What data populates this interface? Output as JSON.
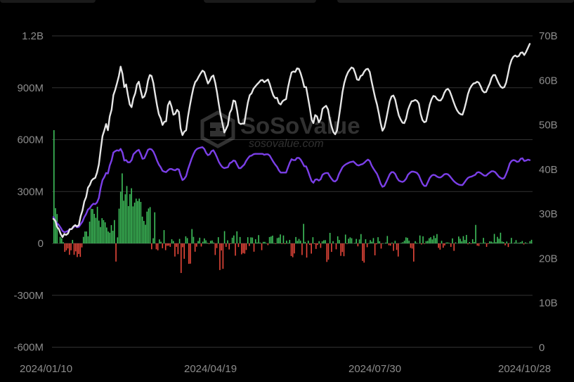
{
  "chart_data": {
    "type": "bar",
    "watermark": {
      "brand": "SoSoValue",
      "url": "sosovalue.com"
    },
    "left_axis": {
      "ticks": [
        {
          "value": 1200000000,
          "label": "1.2B"
        },
        {
          "value": 900000000,
          "label": "900M"
        },
        {
          "value": 600000000,
          "label": "600M"
        },
        {
          "value": 300000000,
          "label": "300M"
        },
        {
          "value": 0,
          "label": "0"
        },
        {
          "value": -300000000,
          "label": "-300M"
        },
        {
          "value": -600000000,
          "label": "-600M"
        }
      ],
      "ylim": [
        -600000000,
        1200000000
      ]
    },
    "right_axis": {
      "ticks": [
        {
          "value": 70000000000,
          "label": "70B"
        },
        {
          "value": 60000000000,
          "label": "60B"
        },
        {
          "value": 50000000000,
          "label": "50B"
        },
        {
          "value": 40000000000,
          "label": "40B"
        },
        {
          "value": 30000000000,
          "label": "30B"
        },
        {
          "value": 20000000000,
          "label": "20B"
        },
        {
          "value": 10000000000,
          "label": "10B"
        },
        {
          "value": 0,
          "label": "0"
        }
      ],
      "ylim": [
        0,
        70000000000
      ]
    },
    "x_ticks": [
      "2024/01/10",
      "2024/04/19",
      "2024/07/30",
      "2024/10/28"
    ],
    "x_range": [
      "2024/01/11",
      "2024/10/30"
    ],
    "grid": true,
    "colors": {
      "positive": "#3fc25c",
      "negative": "#e8473a",
      "line_white": "#e6e6e6",
      "line_purple": "#7b3fe8",
      "grid": "#333333",
      "axis_text": "#8c8c8c",
      "background": "#000000"
    },
    "series": [
      {
        "type": "bar",
        "axis": "left",
        "values": [
          655,
          204,
          170,
          0,
          38,
          29,
          7,
          -49,
          -40,
          -29,
          -66,
          -40,
          20,
          -66,
          -46,
          -79,
          -61,
          -78,
          -23,
          38,
          69,
          69,
          41,
          126,
          200,
          199,
          171,
          148,
          212,
          132,
          95,
          146,
          135,
          122,
          92,
          69,
          62,
          106,
          73,
          135,
          -105,
          35,
          201,
          299,
          405,
          247,
          284,
          332,
          216,
          285,
          319,
          214,
          236,
          259,
          245,
          259,
          240,
          155,
          130,
          108,
          184,
          202,
          210,
          -34,
          30,
          180,
          -34,
          -40,
          23,
          10,
          -28,
          77,
          -39,
          -14,
          -13,
          -20,
          24,
          14,
          -76,
          -20,
          -62,
          26,
          -171,
          -22,
          -89,
          41,
          31,
          -118,
          -117,
          83,
          38,
          -48,
          -19,
          14,
          33,
          -18,
          10,
          29,
          18,
          4,
          -4,
          15,
          17,
          5,
          -67,
          -27,
          36,
          -154,
          -41,
          -147,
          71,
          -20,
          18,
          -35,
          -2,
          33,
          46,
          -71,
          70,
          -21,
          37,
          -63,
          -56,
          -59,
          -38,
          36,
          -15,
          35,
          34,
          -48,
          24,
          5,
          48,
          5,
          -39,
          9,
          9,
          2,
          -10,
          37,
          40,
          45,
          2,
          -2,
          31,
          34,
          52,
          -3,
          46,
          -4,
          16,
          2,
          20,
          -73,
          -80,
          -58,
          37,
          15,
          26,
          16,
          -67,
          113,
          9,
          -82,
          16,
          -9,
          -59,
          36,
          -4,
          -32,
          -9,
          13,
          -26,
          12,
          18,
          19,
          -107,
          -94,
          61,
          -49,
          13,
          0,
          -34,
          41,
          20,
          -72,
          -50,
          -74,
          51,
          -1,
          27,
          35,
          30,
          0,
          3,
          26,
          -17,
          23,
          54,
          -101,
          -111,
          24,
          -22,
          2,
          19,
          10,
          31,
          -69,
          -5,
          36,
          13,
          -30,
          1,
          0,
          5,
          43,
          -11,
          -13,
          5,
          -43,
          15,
          -38,
          -76,
          0,
          3,
          7,
          16,
          35,
          32,
          16,
          -26,
          -30,
          -105,
          13,
          3,
          0,
          46,
          -6,
          41,
          -2,
          13,
          15,
          30,
          36,
          23,
          45,
          31,
          54,
          -26,
          -36,
          15,
          -25,
          -12,
          5,
          6,
          3,
          -20,
          29,
          -43,
          6,
          0,
          40,
          27,
          12,
          42,
          20,
          49,
          -5,
          8,
          -1,
          24,
          8,
          107,
          -13,
          -15,
          3,
          2,
          32,
          5,
          -20,
          -2,
          12,
          11,
          6,
          55,
          7,
          38,
          27,
          62,
          11,
          8,
          -11,
          11,
          -21,
          2,
          32,
          0,
          5,
          19,
          3,
          4,
          7,
          14,
          -6,
          6,
          2,
          0,
          13,
          21
        ]
      },
      {
        "type": "line",
        "axis": "right",
        "color": "#e6e6e6",
        "values": [
          28.9,
          28.5,
          27.1,
          26.6,
          25.5,
          24.8,
          25.5,
          25.3,
          25.6,
          26.6,
          26.6,
          27.2,
          27.5,
          27.2,
          27.5,
          29.5,
          30.8,
          32.8,
          33.8,
          35.9,
          36.5,
          37.5,
          37.9,
          38.1,
          39.3,
          41.1,
          44.4,
          47.5,
          48.8,
          50.2,
          48.8,
          51.9,
          53.4,
          56.7,
          57.9,
          59.4,
          61.0,
          63.1,
          61.5,
          58.5,
          59.1,
          56.7,
          54.6,
          54.0,
          56.0,
          57.1,
          59.1,
          59.7,
          57.8,
          56.1,
          56.4,
          57.6,
          59.9,
          61.2,
          61.0,
          59.4,
          56.8,
          54.4,
          52.4,
          51.5,
          50.0,
          50.7,
          50.8,
          54.4,
          55.3,
          54.1,
          52.3,
          52.5,
          53.4,
          52.9,
          49.2,
          47.7,
          48.5,
          48.8,
          51.8,
          54.2,
          56.4,
          58.3,
          59.6,
          60.1,
          60.9,
          61.6,
          62.2,
          61.9,
          60.6,
          59.3,
          59.9,
          60.8,
          61.1,
          59.5,
          57.3,
          54.6,
          52.2,
          50.3,
          48.3,
          49.1,
          50.0,
          52.7,
          53.5,
          55.5,
          55.3,
          53.3,
          50.5,
          50.2,
          50.3,
          50.3,
          52.8,
          55.1,
          56.7,
          57.1,
          58.1,
          58.6,
          59.1,
          59.5,
          60.0,
          60.1,
          59.6,
          59.9,
          60.2,
          59.2,
          57.8,
          56.6,
          56.0,
          56.1,
          54.9,
          54.6,
          55.3,
          55.6,
          55.8,
          58.3,
          60.2,
          61.8,
          62.0,
          61.9,
          62.7,
          62.6,
          61.6,
          60.2,
          58.5,
          58.5,
          56.2,
          53.9,
          51.2,
          50.4,
          52.2,
          51.9,
          50.6,
          51.3,
          53.6,
          54.0,
          54.3,
          53.5,
          51.4,
          49.7,
          48.4,
          47.9,
          48.8,
          51.6,
          54.4,
          57.4,
          59.4,
          60.8,
          61.8,
          62.4,
          62.9,
          62.7,
          61.6,
          60.2,
          60.1,
          61.0,
          61.2,
          62.0,
          62.5,
          62.6,
          61.9,
          59.8,
          57.9,
          56.1,
          54.6,
          52.6,
          50.4,
          48.7,
          49.4,
          51.2,
          53.3,
          55.3,
          56.4,
          56.6,
          55.7,
          53.8,
          52.1,
          51.2,
          50.5,
          50.4,
          51.4,
          53.3,
          54.4,
          55.3,
          55.4,
          55.6,
          55.4,
          54.8,
          52.5,
          51.1,
          50.6,
          50.8,
          52.7,
          54.6,
          55.8,
          56.5,
          56.4,
          55.8,
          55.5,
          55.5,
          56.1,
          57.2,
          57.9,
          58.1,
          57.6,
          56.5,
          55.3,
          54.2,
          53.3,
          52.7,
          52.4,
          52.3,
          53.5,
          55.1,
          56.9,
          58.1,
          58.8,
          59.3,
          59.4,
          59.7,
          59.5,
          58.7,
          57.7,
          57.3,
          57.4,
          58.4,
          59.3,
          60.6,
          61.2,
          61.2,
          60.2,
          59.3,
          58.6,
          58.3,
          58.5,
          59.5,
          61.3,
          63.3,
          64.6,
          65.3,
          65.6,
          65.3,
          65.5,
          66.2,
          66.3,
          65.7,
          66.4,
          67.3,
          68.2
        ]
      },
      {
        "type": "line",
        "axis": "right",
        "color": "#7b3fe8",
        "values": [
          29.3,
          28.5,
          27.9,
          27.5,
          26.9,
          26.2,
          25.9,
          26.0,
          26.2,
          26.6,
          26.6,
          27.0,
          27.4,
          27.0,
          27.1,
          27.7,
          28.3,
          29.3,
          30.0,
          31.0,
          31.3,
          31.9,
          32.3,
          32.2,
          32.6,
          33.6,
          35.9,
          37.6,
          38.3,
          39.2,
          39.1,
          40.9,
          42.0,
          43.8,
          44.1,
          44.3,
          44.2,
          44.6,
          43.8,
          42.0,
          42.1,
          41.6,
          41.6,
          42.1,
          43.4,
          43.8,
          44.2,
          44.4,
          43.5,
          42.4,
          42.5,
          43.4,
          44.4,
          44.6,
          44.5,
          44.0,
          43.1,
          42.0,
          41.1,
          40.5,
          39.7,
          39.5,
          39.4,
          39.8,
          40.1,
          40.1,
          39.9,
          39.8,
          40.1,
          40.0,
          38.7,
          37.6,
          37.9,
          38.5,
          40.0,
          41.2,
          42.4,
          43.4,
          44.2,
          44.6,
          44.8,
          44.9,
          45.0,
          44.6,
          43.7,
          43.2,
          43.4,
          44.1,
          44.3,
          43.6,
          42.7,
          41.7,
          41.0,
          40.5,
          40.3,
          40.4,
          40.5,
          41.4,
          41.6,
          42.0,
          41.9,
          41.1,
          40.3,
          40.3,
          40.7,
          41.1,
          41.9,
          42.5,
          43.0,
          43.1,
          43.4,
          43.5,
          43.5,
          43.5,
          43.5,
          43.5,
          43.3,
          43.4,
          43.4,
          43.1,
          42.4,
          41.7,
          41.1,
          40.6,
          39.8,
          39.3,
          39.3,
          39.3,
          39.3,
          40.4,
          41.5,
          42.3,
          42.1,
          42.1,
          42.6,
          42.6,
          42.2,
          41.5,
          40.7,
          40.7,
          39.7,
          38.5,
          37.4,
          37.0,
          37.7,
          37.8,
          37.5,
          37.8,
          38.8,
          39.1,
          39.2,
          39.2,
          38.5,
          37.9,
          37.4,
          37.3,
          37.7,
          38.9,
          39.7,
          40.5,
          40.9,
          41.2,
          41.4,
          41.6,
          41.7,
          41.8,
          41.4,
          41.0,
          40.9,
          41.1,
          41.2,
          41.5,
          41.9,
          42.2,
          41.9,
          40.9,
          40.2,
          39.6,
          39.0,
          38.0,
          36.8,
          36.1,
          36.3,
          37.1,
          38.0,
          38.9,
          39.4,
          39.4,
          39.0,
          38.1,
          37.5,
          37.3,
          37.2,
          37.4,
          37.9,
          38.8,
          39.2,
          39.5,
          39.5,
          39.4,
          39.2,
          38.7,
          37.7,
          36.8,
          36.3,
          36.3,
          37.2,
          38.1,
          38.6,
          38.8,
          38.7,
          38.4,
          38.2,
          38.2,
          38.5,
          38.9,
          39.0,
          38.9,
          38.5,
          38.0,
          37.5,
          37.1,
          36.8,
          36.6,
          36.5,
          36.5,
          37.0,
          37.6,
          38.1,
          38.3,
          38.4,
          38.6,
          38.8,
          39.3,
          39.4,
          39.2,
          38.9,
          38.6,
          38.6,
          39.0,
          39.3,
          39.6,
          39.6,
          39.4,
          38.9,
          38.4,
          38.1,
          37.9,
          38.1,
          39.0,
          40.0,
          41.3,
          41.9,
          42.1,
          42.0,
          41.7,
          41.8,
          42.4,
          42.5,
          41.9,
          42.0,
          42.2,
          42.1
        ]
      }
    ]
  }
}
